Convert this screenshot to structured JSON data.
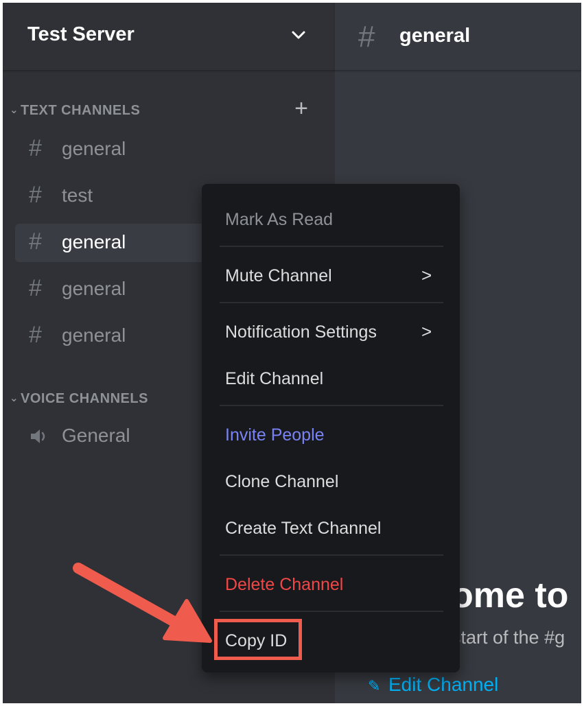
{
  "sidebar": {
    "server_name": "Test Server",
    "categories": [
      {
        "label": "TEXT CHANNELS"
      },
      {
        "label": "VOICE CHANNELS"
      }
    ],
    "text_channels": [
      {
        "name": "general",
        "selected": false
      },
      {
        "name": "test",
        "selected": false
      },
      {
        "name": "general",
        "selected": true
      },
      {
        "name": "general",
        "selected": false
      },
      {
        "name": "general",
        "selected": false
      }
    ],
    "voice_channels": [
      {
        "name": "General"
      }
    ],
    "hash_symbol": "#",
    "add_symbol": "+"
  },
  "main": {
    "channel_title": "general",
    "hash_symbol": "#",
    "welcome_heading": "ome to",
    "welcome_sub": "start of the #g",
    "edit_link": "Edit Channel"
  },
  "context_menu": {
    "items": [
      {
        "label": "Mark As Read"
      },
      {
        "label": "Mute Channel"
      },
      {
        "label": "Notification Settings"
      },
      {
        "label": "Edit Channel"
      },
      {
        "label": "Invite People"
      },
      {
        "label": "Clone Channel"
      },
      {
        "label": "Create Text Channel"
      },
      {
        "label": "Delete Channel"
      },
      {
        "label": "Copy ID"
      }
    ],
    "submenu_arrow": ">"
  },
  "colors": {
    "sidebar_bg": "#2f3136",
    "main_bg": "#36393f",
    "menu_bg": "#18191c",
    "invite_blue": "#7983f5",
    "delete_red": "#f04747",
    "annotation_red": "#ef5b4c",
    "link_blue": "#00b0f4"
  }
}
